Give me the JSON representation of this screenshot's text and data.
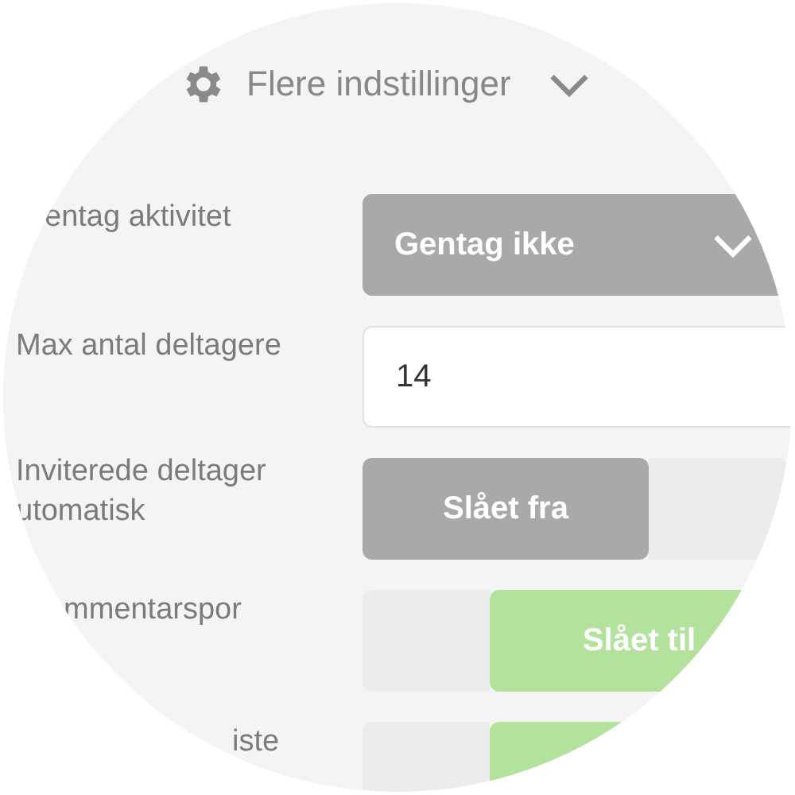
{
  "header": {
    "title": "Flere indstillinger"
  },
  "rows": [
    {
      "kind": "dropdown",
      "label": "entag aktivitet",
      "value": "Gentag ikke"
    },
    {
      "kind": "input",
      "label": "Max antal deltagere",
      "value": "14"
    },
    {
      "kind": "toggle",
      "label": "Inviterede deltager utomatisk",
      "on": false,
      "state_text": "Slået fra"
    },
    {
      "kind": "toggle",
      "label": "mmentarspor",
      "on": true,
      "state_text": "Slået til"
    },
    {
      "kind": "toggle",
      "label": "iste",
      "on": true
    }
  ]
}
